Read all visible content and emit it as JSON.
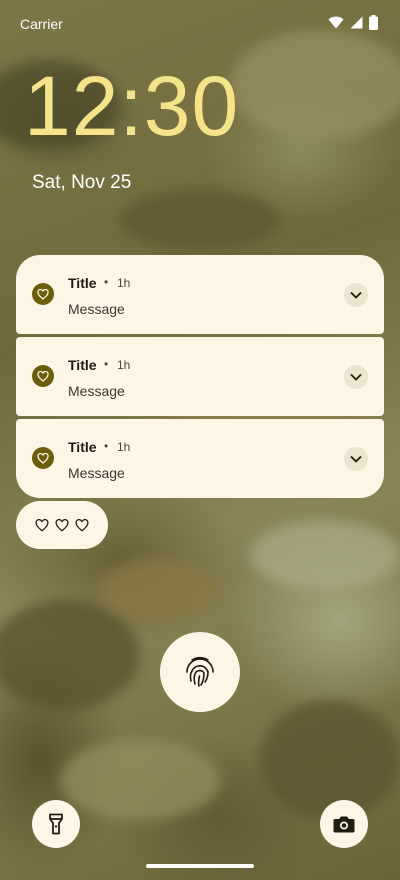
{
  "status_bar": {
    "carrier": "Carrier",
    "icons": [
      "wifi-icon",
      "signal-icon",
      "battery-icon"
    ]
  },
  "lockscreen": {
    "time": "12:30",
    "date": "Sat, Nov 25"
  },
  "notifications": [
    {
      "title": "Title",
      "separator": "•",
      "time": "1h",
      "message": "Message",
      "icon": "heart-icon"
    },
    {
      "title": "Title",
      "separator": "•",
      "time": "1h",
      "message": "Message",
      "icon": "heart-icon"
    },
    {
      "title": "Title",
      "separator": "•",
      "time": "1h",
      "message": "Message",
      "icon": "heart-icon"
    }
  ],
  "shelf": {
    "icons": [
      "heart-icon",
      "heart-icon",
      "heart-icon"
    ]
  },
  "shortcuts": {
    "left": "flashlight-icon",
    "center": "fingerprint-icon",
    "right": "camera-icon"
  },
  "colors": {
    "clock": "#f3e38a",
    "card": "#fdf6e7",
    "accent": "#6b5d0c"
  }
}
